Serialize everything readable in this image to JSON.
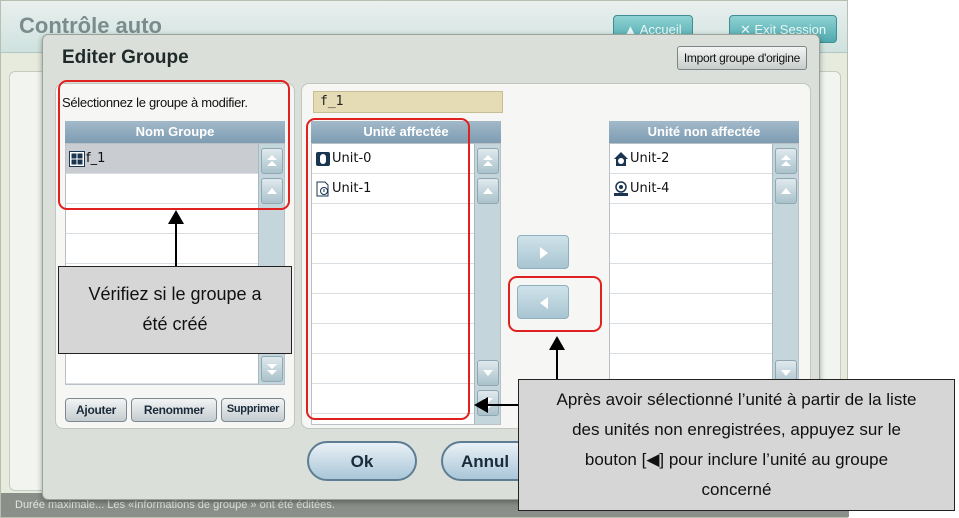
{
  "background": {
    "app_title": "Contrôle auto",
    "home_button": "Accueil",
    "exit_button": "Exit Session",
    "status_text": "Durée maximale... Les «Informations de groupe » ont été éditées."
  },
  "dialog": {
    "title": "Editer Groupe",
    "import_button": "Import groupe d'origine",
    "prompt": "Sélectionnez le groupe à modifier.",
    "group_name_value": "f_1",
    "group_list": {
      "header": "Nom Groupe",
      "items": [
        {
          "label": "f_1",
          "icon": "group-grid-icon",
          "selected": true
        }
      ]
    },
    "buttons": {
      "add": "Ajouter",
      "rename": "Renommer",
      "delete": "Supprimer",
      "ok": "Ok",
      "cancel": "Annul"
    },
    "assigned_list": {
      "header": "Unité affectée",
      "items": [
        {
          "label": "Unit-0",
          "icon": "indoor-unit-icon"
        },
        {
          "label": "Unit-1",
          "icon": "ventilation-unit-icon"
        }
      ]
    },
    "unassigned_list": {
      "header": "Unité non affectée",
      "items": [
        {
          "label": "Unit-2",
          "icon": "house-unit-icon"
        },
        {
          "label": "Unit-4",
          "icon": "awhp-unit-icon"
        }
      ]
    }
  },
  "annotations": {
    "callout_left": [
      "Vérifiez si le groupe a",
      "été créé"
    ],
    "callout_right": [
      "Après avoir sélectionné l’unité à partir de la liste",
      "des unités non enregistrées, appuyez sur le",
      "bouton [◀] pour inclure l’unité au groupe",
      "concerné"
    ],
    "colors": {
      "highlight": "#e0211f",
      "callout_bg": "#d6d6d6"
    }
  }
}
